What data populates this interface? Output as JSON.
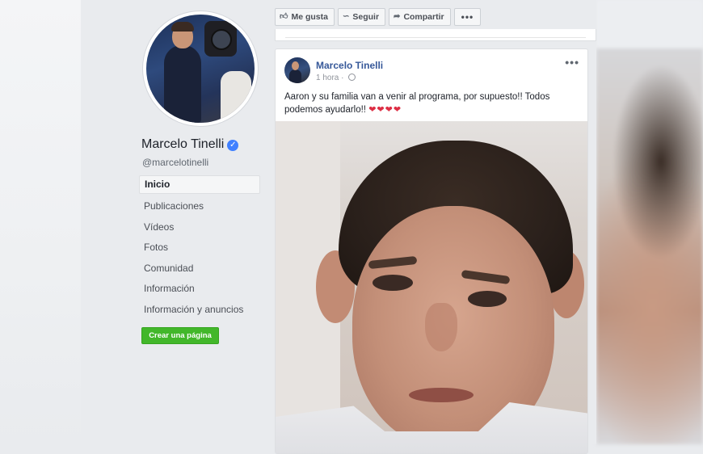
{
  "profile": {
    "name": "Marcelo Tinelli",
    "handle": "@marcelotinelli",
    "verified_symbol": "✓",
    "nav": [
      {
        "label": "Inicio",
        "active": true
      },
      {
        "label": "Publicaciones"
      },
      {
        "label": "Vídeos"
      },
      {
        "label": "Fotos"
      },
      {
        "label": "Comunidad"
      },
      {
        "label": "Información"
      },
      {
        "label": "Información y anuncios"
      }
    ],
    "create_page_label": "Crear una página"
  },
  "actions": {
    "like_label": "Me gusta",
    "follow_label": "Seguir",
    "share_label": "Compartir",
    "more_label": "•••",
    "like_icon": "thumbs-up-icon",
    "follow_icon": "rss-icon",
    "share_icon": "share-arrow-icon"
  },
  "post": {
    "author": "Marcelo Tinelli",
    "time": "1 hora",
    "menu_label": "•••",
    "text": "Aaron y su familia van a venir al programa, por supuesto!! Todos podemos ayudarlo!!",
    "hearts": "❤❤❤❤"
  },
  "colors": {
    "link_blue": "#365899",
    "create_green": "#42b72a",
    "verified_blue": "#4080ff",
    "heart_red": "#dd2e44"
  }
}
